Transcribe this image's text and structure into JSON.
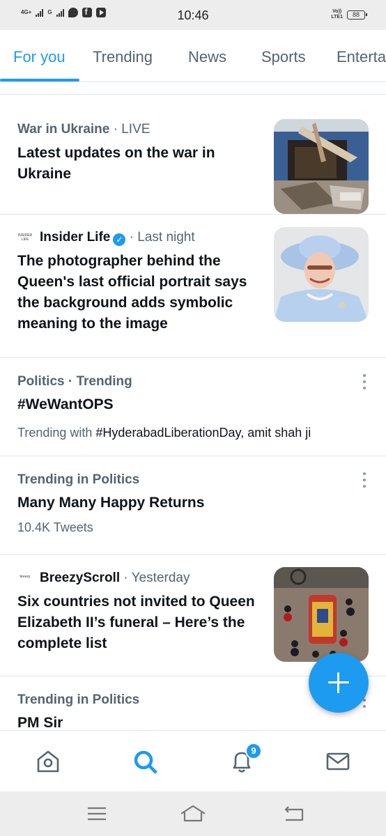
{
  "status_bar": {
    "network_left": "4G+",
    "network_right": "G",
    "time": "10:46",
    "volte_line1": "Vo))",
    "volte_line2": "LTE1",
    "battery": "88"
  },
  "tabs": [
    {
      "label": "For you"
    },
    {
      "label": "Trending"
    },
    {
      "label": "News"
    },
    {
      "label": "Sports"
    },
    {
      "label": "Entertainment"
    }
  ],
  "feed": {
    "card1": {
      "topic": "War in Ukraine",
      "status": "LIVE",
      "headline": "Latest updates on the war in Ukraine",
      "image_icon": "destroyed-building-photo"
    },
    "card2": {
      "source_logo": "INSIDER LIFE",
      "source": "Insider Life",
      "time": "Last night",
      "headline": "The photographer behind the Queen's last official portrait says the background adds symbolic meaning to the image",
      "image_icon": "queen-portrait-photo"
    },
    "card3": {
      "category": "Politics · Trending",
      "title": "#WeWantOPS",
      "trending_with_label": "Trending with",
      "trending_with_items": "#HyderabadLiberationDay, amit shah ji"
    },
    "card4": {
      "category": "Trending in Politics",
      "title": "Many Many Happy Returns",
      "tweets": "10.4K Tweets"
    },
    "card5": {
      "source_logo": "breezy",
      "source": "BreezyScroll",
      "time": "Yesterday",
      "headline": "Six countries not invited to Queen Elizabeth II’s funeral – Here’s the complete list",
      "image_icon": "funeral-procession-photo"
    },
    "card6": {
      "category": "Trending in Politics",
      "title": "PM Sir"
    }
  },
  "bottom_nav": {
    "notification_count": "9"
  },
  "colors": {
    "accent": "#1d9bf0",
    "text_primary": "#0f1419",
    "text_secondary": "#536471"
  }
}
